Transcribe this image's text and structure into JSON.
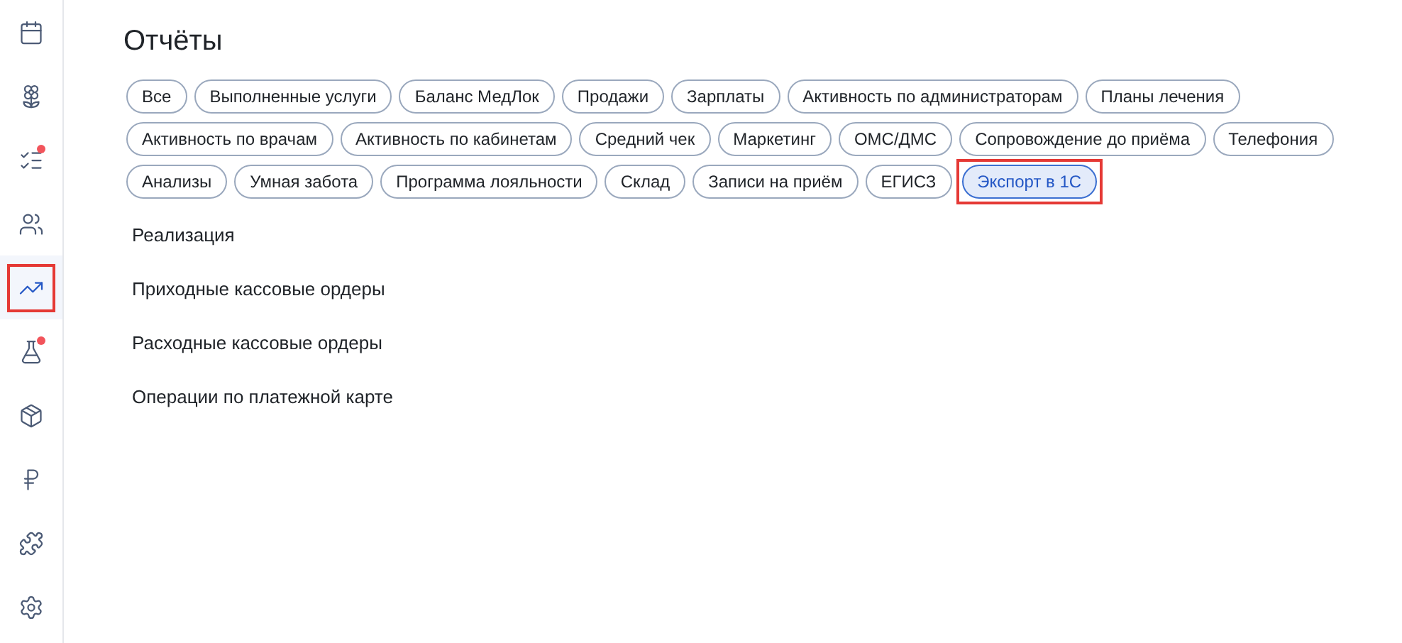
{
  "sidebar": {
    "items": [
      {
        "kind": "calendar",
        "selected": false,
        "badge": false,
        "highlighted": false
      },
      {
        "kind": "flower",
        "selected": false,
        "badge": false,
        "highlighted": false
      },
      {
        "kind": "checklist",
        "selected": false,
        "badge": true,
        "highlighted": false
      },
      {
        "kind": "users",
        "selected": false,
        "badge": false,
        "highlighted": false
      },
      {
        "kind": "chart",
        "selected": true,
        "badge": false,
        "highlighted": true
      },
      {
        "kind": "flask",
        "selected": false,
        "badge": true,
        "highlighted": false
      },
      {
        "kind": "package",
        "selected": false,
        "badge": false,
        "highlighted": false
      },
      {
        "kind": "ruble",
        "selected": false,
        "badge": false,
        "highlighted": false
      },
      {
        "kind": "puzzle",
        "selected": false,
        "badge": false,
        "highlighted": false
      },
      {
        "kind": "settings",
        "selected": false,
        "badge": false,
        "highlighted": false
      }
    ]
  },
  "title": "Отчёты",
  "filter_rows": [
    [
      {
        "label": "Все",
        "selected": false,
        "highlighted": false
      },
      {
        "label": "Выполненные услуги",
        "selected": false,
        "highlighted": false
      },
      {
        "label": "Баланс МедЛок",
        "selected": false,
        "highlighted": false
      },
      {
        "label": "Продажи",
        "selected": false,
        "highlighted": false
      },
      {
        "label": "Зарплаты",
        "selected": false,
        "highlighted": false
      },
      {
        "label": "Активность по администраторам",
        "selected": false,
        "highlighted": false
      },
      {
        "label": "Планы лечения",
        "selected": false,
        "highlighted": false
      }
    ],
    [
      {
        "label": "Активность по врачам",
        "selected": false,
        "highlighted": false
      },
      {
        "label": "Активность по кабинетам",
        "selected": false,
        "highlighted": false
      },
      {
        "label": "Средний чек",
        "selected": false,
        "highlighted": false
      },
      {
        "label": "Маркетинг",
        "selected": false,
        "highlighted": false
      },
      {
        "label": "ОМС/ДМС",
        "selected": false,
        "highlighted": false
      },
      {
        "label": "Сопровождение до приёма",
        "selected": false,
        "highlighted": false
      },
      {
        "label": "Телефония",
        "selected": false,
        "highlighted": false
      }
    ],
    [
      {
        "label": "Анализы",
        "selected": false,
        "highlighted": false
      },
      {
        "label": "Умная забота",
        "selected": false,
        "highlighted": false
      },
      {
        "label": "Программа лояльности",
        "selected": false,
        "highlighted": false
      },
      {
        "label": "Склад",
        "selected": false,
        "highlighted": false
      },
      {
        "label": "Записи на приём",
        "selected": false,
        "highlighted": false
      },
      {
        "label": "ЕГИСЗ",
        "selected": false,
        "highlighted": false
      },
      {
        "label": "Экспорт в 1С",
        "selected": true,
        "highlighted": true
      }
    ]
  ],
  "reports": [
    "Реализация",
    "Приходные кассовые ордеры",
    "Расходные кассовые ордеры",
    "Операции по платежной карте"
  ]
}
